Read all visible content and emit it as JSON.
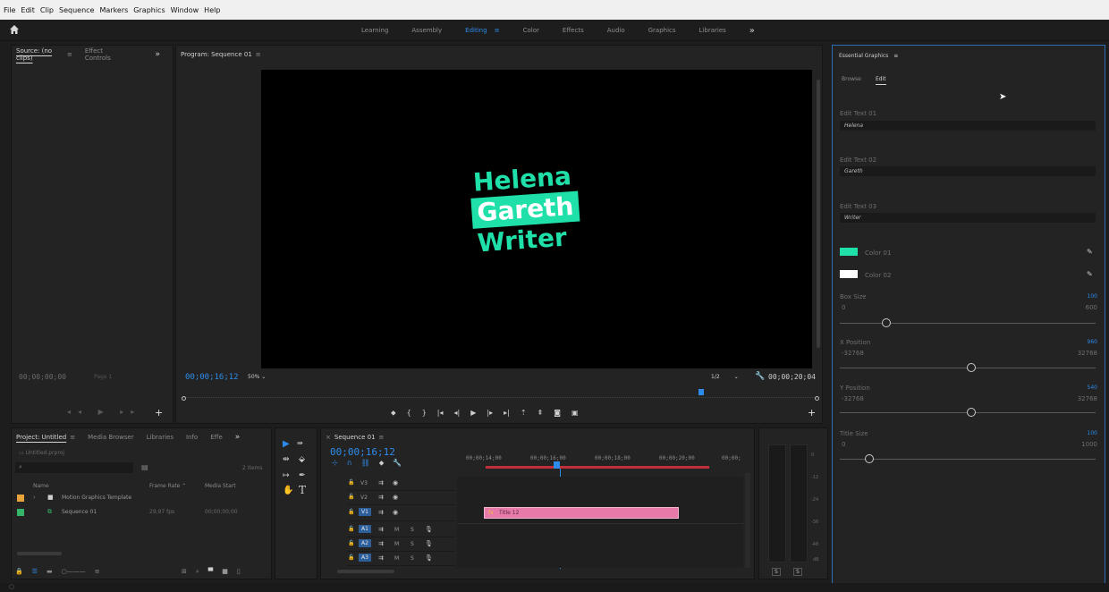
{
  "menu": [
    "File",
    "Edit",
    "Clip",
    "Sequence",
    "Markers",
    "Graphics",
    "Window",
    "Help"
  ],
  "workspaces": [
    {
      "label": "Learning",
      "active": false
    },
    {
      "label": "Assembly",
      "active": false
    },
    {
      "label": "Editing",
      "active": true
    },
    {
      "label": "Color",
      "active": false
    },
    {
      "label": "Effects",
      "active": false
    },
    {
      "label": "Audio",
      "active": false
    },
    {
      "label": "Graphics",
      "active": false
    },
    {
      "label": "Libraries",
      "active": false
    }
  ],
  "overflow": "»",
  "source_panel": {
    "tab_source": "Source: (no clips)",
    "tab_effect_controls": "Effect Controls",
    "timecode": "00;00;00;00",
    "page": "Page 1"
  },
  "program_panel": {
    "title": "Program: Sequence 01",
    "timecode": "00;00;16;12",
    "zoom": "50%",
    "resolution": "1/2",
    "duration": "00;00;20;04",
    "title_line1": "Helena",
    "title_line2": "Gareth",
    "title_line3": "Writer"
  },
  "project_panel": {
    "tabs": [
      "Project: Untitled",
      "Media Browser",
      "Libraries",
      "Info",
      "Effe"
    ],
    "file": "Untitled.prproj",
    "items_count": "2 Items",
    "columns": {
      "name": "Name",
      "frame_rate": "Frame Rate",
      "media_start": "Media Start"
    },
    "rows": [
      {
        "name": "Motion Graphics Template",
        "frame_rate": "",
        "media_start": "",
        "color": "#e8a33a"
      },
      {
        "name": "Sequence 01",
        "frame_rate": "29,97 fps",
        "media_start": "00;00;00;00",
        "color": "#35b56a"
      }
    ]
  },
  "timeline": {
    "tab": "Sequence 01",
    "timecode": "00;00;16;12",
    "ruler": [
      "00;00;14;00",
      "00;00;16;00",
      "00;00;18;00",
      "00;00;20;00",
      "00;00;"
    ],
    "video_tracks": [
      "V3",
      "V2",
      "V1"
    ],
    "audio_tracks": [
      "A1",
      "A2",
      "A3"
    ],
    "clip_label": "Title 12",
    "mute": "M",
    "solo": "S"
  },
  "meter": {
    "ticks": [
      "0",
      "-12",
      "-24",
      "-36",
      "-48",
      "dB"
    ],
    "solo_left": "S",
    "solo_right": "S"
  },
  "essential_graphics": {
    "title": "Essential Graphics",
    "tab_browse": "Browse",
    "tab_edit": "Edit",
    "edit_text_01_label": "Edit Text 01",
    "edit_text_01_value": "Helena",
    "edit_text_02_label": "Edit Text 02",
    "edit_text_02_value": "Gareth",
    "edit_text_03_label": "Edit Text 03",
    "edit_text_03_value": "Writer",
    "color_01_label": "Color 01",
    "color_01": "#1fe0a8",
    "color_02_label": "Color 02",
    "color_02": "#ffffff",
    "box_size_label": "Box Size",
    "box_size_value": "100",
    "box_size_min": "0",
    "box_size_max": "600",
    "x_position_label": "X Position",
    "x_position_value": "960",
    "x_position_min": "-32768",
    "x_position_max": "32768",
    "y_position_label": "Y Position",
    "y_position_value": "540",
    "y_position_min": "-32768",
    "y_position_max": "32768",
    "title_size_label": "Title Size",
    "title_size_value": "100",
    "title_size_min": "0",
    "title_size_max": "1000"
  },
  "colors": {
    "accent": "#2d8ceb",
    "title_teal": "#1fe0a8",
    "clip_pink": "#e87aa9"
  }
}
